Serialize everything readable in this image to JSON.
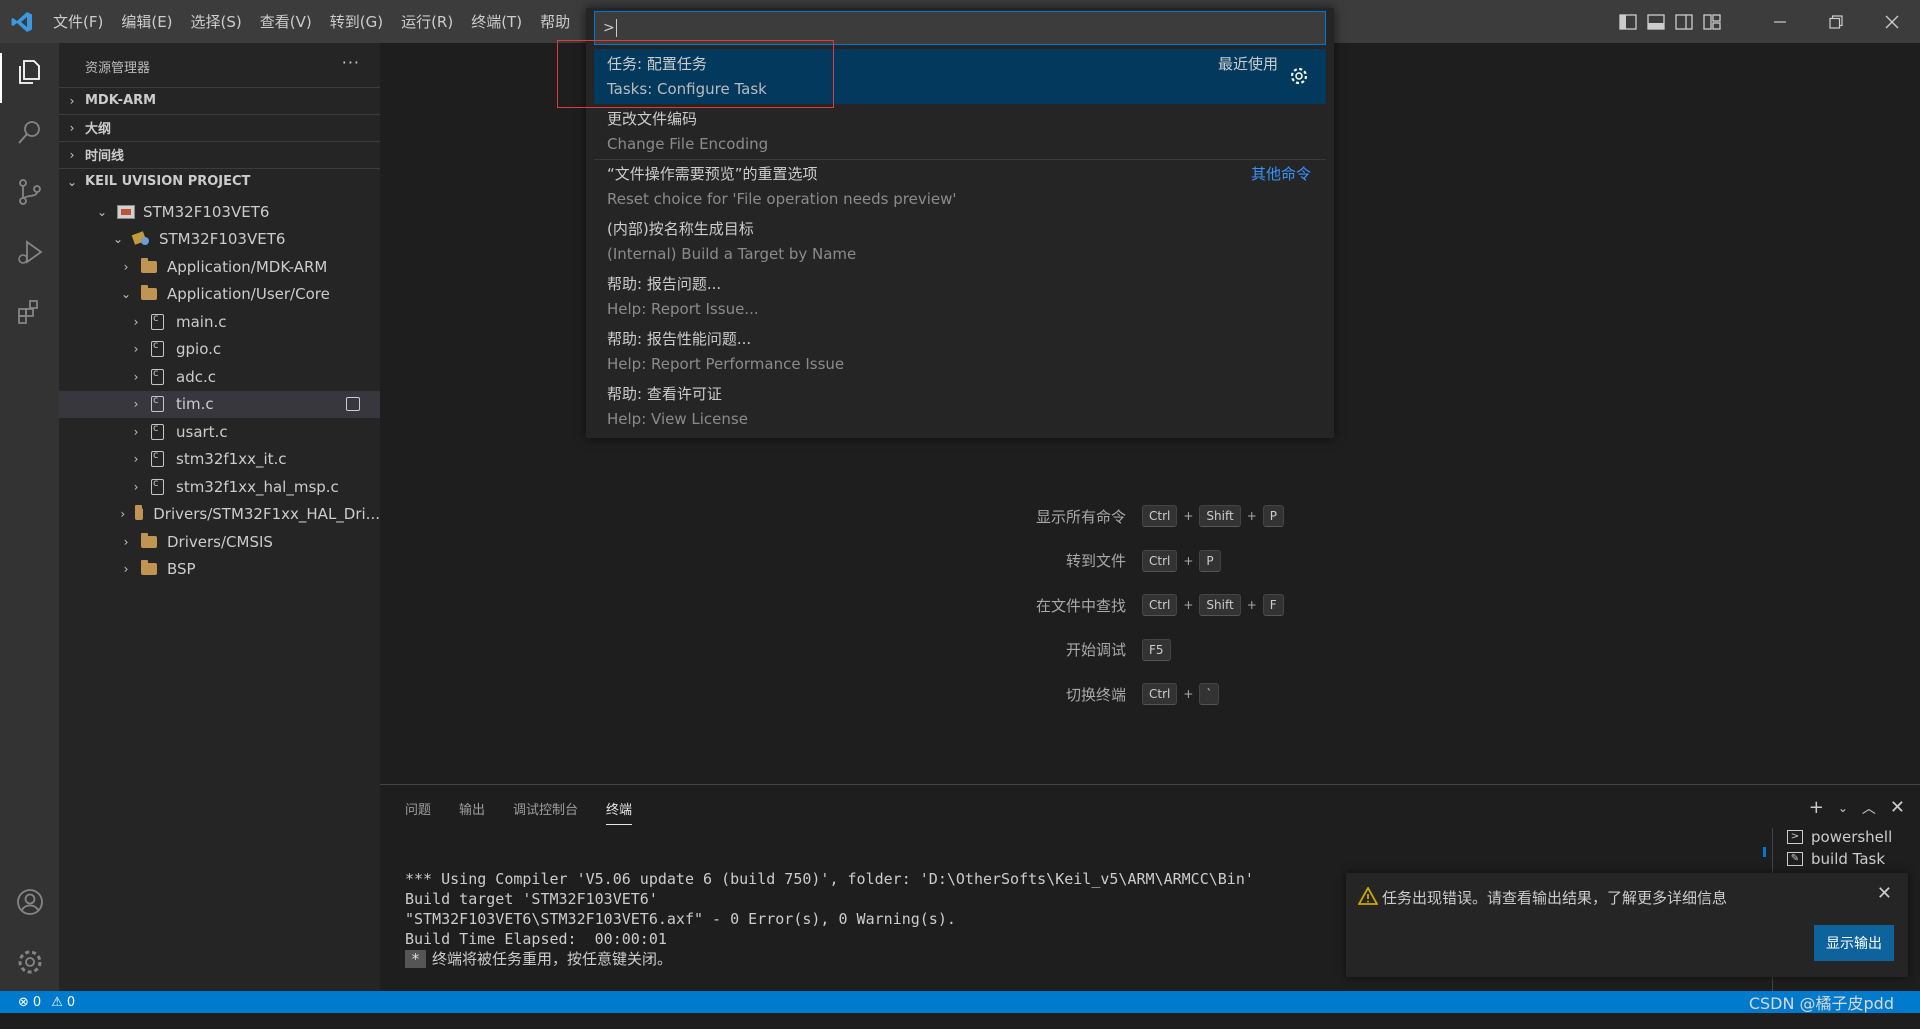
{
  "titlebar": {
    "menu": [
      "文件(F)",
      "编辑(E)",
      "选择(S)",
      "查看(V)",
      "转到(G)",
      "运行(R)",
      "终端(T)",
      "帮助"
    ]
  },
  "sidebar": {
    "title": "资源管理器",
    "more": "···",
    "sections": {
      "mdk": "MDK-ARM",
      "outline": "大纲",
      "timeline": "时间线",
      "keil": "KEIL UVISION PROJECT"
    },
    "tree": [
      {
        "label": "STM32F103VET6",
        "kind": "project"
      },
      {
        "label": "STM32F103VET6",
        "kind": "target"
      },
      {
        "label": "Application/MDK-ARM",
        "kind": "folder"
      },
      {
        "label": "Application/User/Core",
        "kind": "folder"
      },
      {
        "label": "main.c",
        "kind": "file"
      },
      {
        "label": "gpio.c",
        "kind": "file"
      },
      {
        "label": "adc.c",
        "kind": "file"
      },
      {
        "label": "tim.c",
        "kind": "file"
      },
      {
        "label": "usart.c",
        "kind": "file"
      },
      {
        "label": "stm32f1xx_it.c",
        "kind": "file"
      },
      {
        "label": "stm32f1xx_hal_msp.c",
        "kind": "file"
      },
      {
        "label": "Drivers/STM32F1xx_HAL_Dri...",
        "kind": "folder"
      },
      {
        "label": "Drivers/CMSIS",
        "kind": "folder"
      },
      {
        "label": "BSP",
        "kind": "folder"
      }
    ]
  },
  "palette": {
    "input_value": ">",
    "items": [
      {
        "label": "任务: 配置任务",
        "detail": "Tasks: Configure Task",
        "tag": "最近使用"
      },
      {
        "label": "更改文件编码",
        "detail": "Change File Encoding",
        "tag": ""
      },
      {
        "label": "“文件操作需要预览”的重置选项",
        "detail": "Reset choice for 'File operation needs preview'",
        "tag": "其他命令"
      },
      {
        "label": "(内部)按名称生成目标",
        "detail": "(Internal) Build a Target by Name",
        "tag": ""
      },
      {
        "label": "帮助: 报告问题...",
        "detail": "Help: Report Issue...",
        "tag": ""
      },
      {
        "label": "帮助: 报告性能问题...",
        "detail": "Help: Report Performance Issue",
        "tag": ""
      },
      {
        "label": "帮助: 查看许可证",
        "detail": "Help: View License",
        "tag": ""
      }
    ]
  },
  "shortcuts": [
    {
      "label": "显示所有命令",
      "keys": [
        "Ctrl",
        "Shift",
        "P"
      ]
    },
    {
      "label": "转到文件",
      "keys": [
        "Ctrl",
        "P"
      ]
    },
    {
      "label": "在文件中查找",
      "keys": [
        "Ctrl",
        "Shift",
        "F"
      ]
    },
    {
      "label": "开始调试",
      "keys": [
        "F5"
      ]
    },
    {
      "label": "切换终端",
      "keys": [
        "Ctrl",
        "`"
      ]
    }
  ],
  "panel": {
    "tabs": [
      "问题",
      "输出",
      "调试控制台",
      "终端"
    ],
    "terminal_lines": [
      "*** Using Compiler 'V5.06 update 6 (build 750)', folder: 'D:\\OtherSofts\\Keil_v5\\ARM\\ARMCC\\Bin'",
      "Build target 'STM32F103VET6'",
      "\"STM32F103VET6\\STM32F103VET6.axf\" - 0 Error(s), 0 Warning(s).",
      "Build Time Elapsed:  00:00:01"
    ],
    "terminal_marker": "*",
    "terminal_last": "终端将被任务重用，按任意键关闭。",
    "terminal_list": [
      "powershell",
      "build  Task"
    ]
  },
  "toast": {
    "message": "任务出现错误。请查看输出结果，了解更多详细信息",
    "button": "显示输出"
  },
  "statusbar": {
    "errors": "0",
    "warnings": "0",
    "watermark": "CSDN @橘子皮pdd"
  },
  "colors": {
    "accent": "#007acc",
    "selection": "#04395e",
    "highlight_box": "#e03a3a"
  }
}
